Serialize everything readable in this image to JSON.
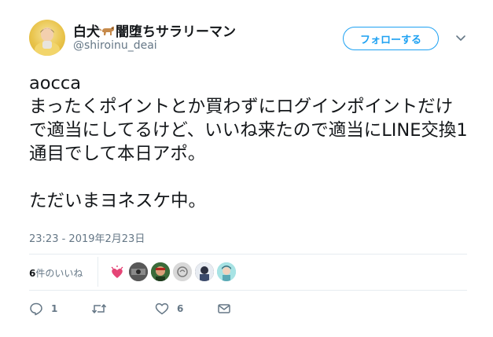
{
  "header": {
    "display_name_prefix": "白犬",
    "display_name_suffix": "闇堕ちサラリーマン",
    "handle": "@shiroinu_deai",
    "follow_label": "フォローする"
  },
  "tweet": {
    "text": "aocca\nまったくポイントとか買わずにログインポイントだけで適当にしてるけど、いいね来たので適当にLINE交換1通目でして本日アポ。\n\nただいまヨネスケ中。",
    "timestamp": "23:23 - 2019年2月23日"
  },
  "likes": {
    "count": "6",
    "label": "件のいいね",
    "liker_icons": [
      "liker-1-avatar",
      "liker-2-avatar",
      "liker-3-avatar",
      "liker-4-avatar",
      "liker-5-avatar"
    ]
  },
  "actions": {
    "reply_count": "1",
    "retweet_count": "",
    "like_count": "6"
  },
  "colors": {
    "accent": "#1da1f2",
    "secondary_text": "#657786",
    "like_heart": "#e0245e"
  }
}
